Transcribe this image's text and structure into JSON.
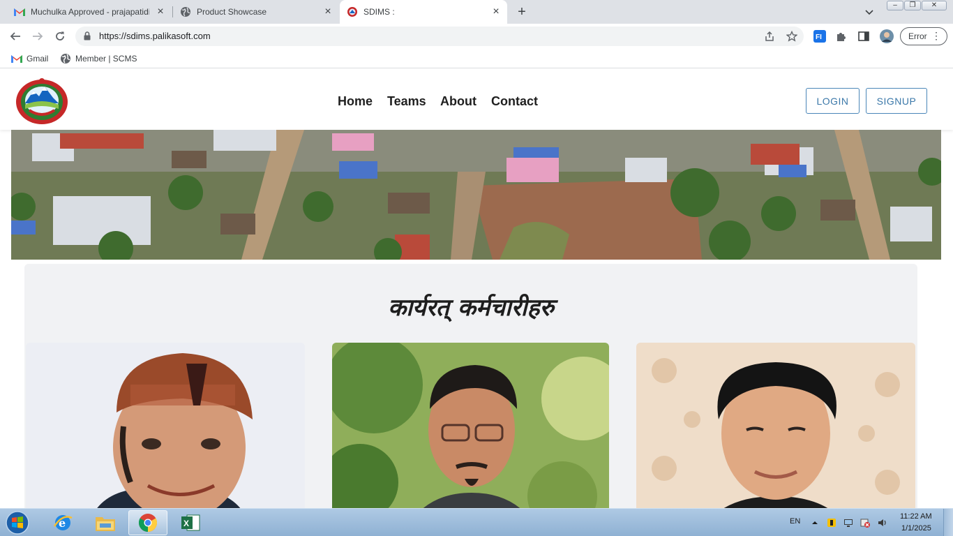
{
  "browser": {
    "tabs": [
      {
        "title": "Muchulka Approved - prajapatidi",
        "favicon": "gmail-icon",
        "active": false
      },
      {
        "title": "Product Showcase",
        "favicon": "globe-icon",
        "active": false
      },
      {
        "title": "SDIMS :",
        "favicon": "site-emblem-icon",
        "active": true
      }
    ],
    "url": "https://sdims.palikasoft.com",
    "profile_status": "Error",
    "bookmarks": [
      {
        "label": "Gmail",
        "icon": "gmail-icon"
      },
      {
        "label": "Member | SCMS",
        "icon": "globe-icon"
      }
    ]
  },
  "site": {
    "nav": {
      "home": "Home",
      "teams": "Teams",
      "about": "About",
      "contact": "Contact"
    },
    "auth": {
      "login": "LOGIN",
      "signup": "SIGNUP"
    },
    "staff_heading": "कार्यरत् कर्मचारीहरु",
    "colors": {
      "accent": "#3b78a9",
      "section_bg": "#f1f2f4",
      "nav_text": "#1f1f1f"
    }
  },
  "taskbar": {
    "language": "EN",
    "time": "11:22 AM",
    "date": "1/1/2025",
    "apps": [
      "internet-explorer-icon",
      "file-explorer-icon",
      "chrome-icon",
      "excel-icon"
    ]
  }
}
